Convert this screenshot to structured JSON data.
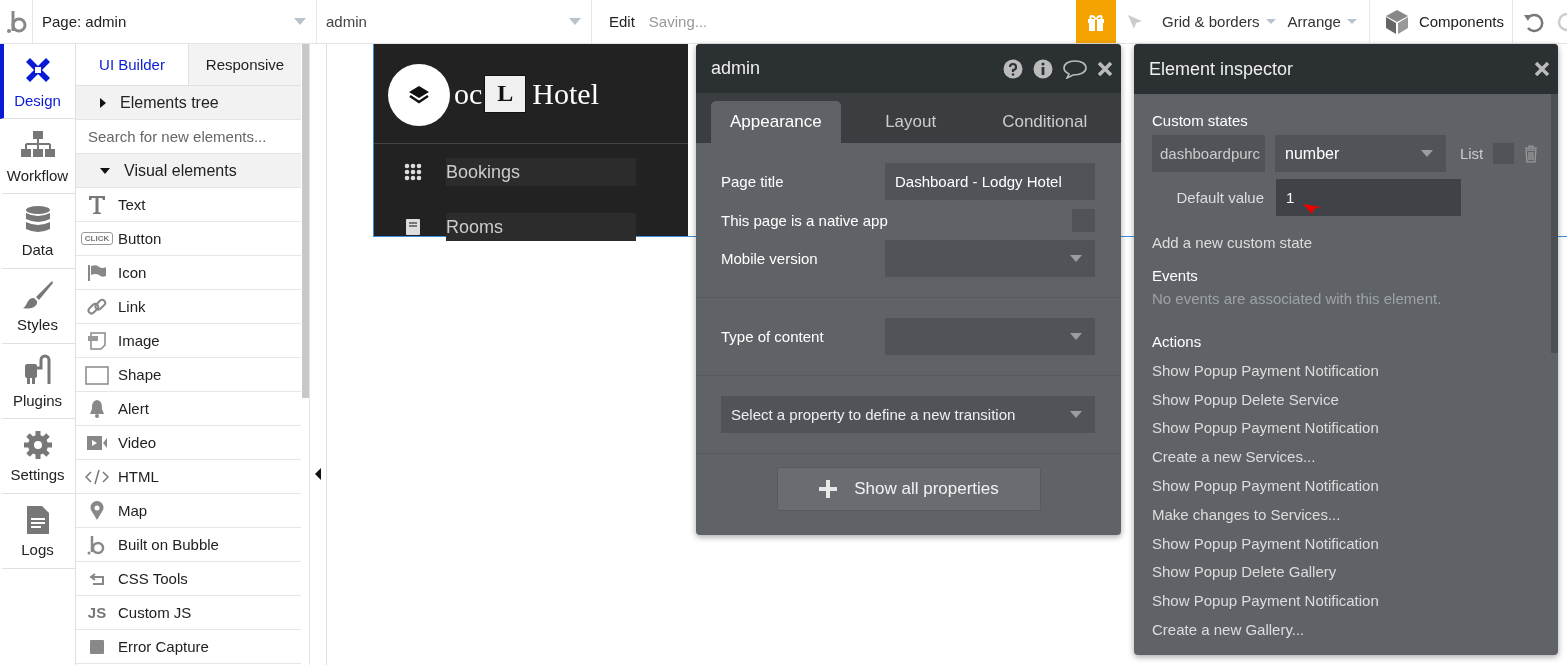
{
  "topbar": {
    "page_dropdown": "Page: admin",
    "element_dropdown": "admin",
    "edit": "Edit",
    "status": "Saving...",
    "grid_menu": "Grid & borders",
    "arrange_menu": "Arrange",
    "components": "Components"
  },
  "nav": [
    {
      "label": "Design",
      "kind": "design",
      "selected": true
    },
    {
      "label": "Workflow",
      "kind": "workflow",
      "selected": false
    },
    {
      "label": "Data",
      "kind": "data",
      "selected": false
    },
    {
      "label": "Styles",
      "kind": "styles",
      "selected": false
    },
    {
      "label": "Plugins",
      "kind": "plugins",
      "selected": false
    },
    {
      "label": "Settings",
      "kind": "settings",
      "selected": false
    },
    {
      "label": "Logs",
      "kind": "logs",
      "selected": false
    }
  ],
  "panel": {
    "tabs": [
      {
        "label": "UI Builder",
        "selected": true
      },
      {
        "label": "Responsive",
        "selected": false
      }
    ],
    "elements_tree": {
      "label": "Elements tree",
      "expanded": false
    },
    "search": {
      "placeholder": "Search for new elements..."
    },
    "visual_elements": {
      "label": "Visual elements",
      "expanded": true
    },
    "items": [
      {
        "label": "Text",
        "kind": "text"
      },
      {
        "label": "Button",
        "kind": "button",
        "badge": "CLICK"
      },
      {
        "label": "Icon",
        "kind": "icon"
      },
      {
        "label": "Link",
        "kind": "link"
      },
      {
        "label": "Image",
        "kind": "image"
      },
      {
        "label": "Shape",
        "kind": "shape"
      },
      {
        "label": "Alert",
        "kind": "alert"
      },
      {
        "label": "Video",
        "kind": "video"
      },
      {
        "label": "HTML",
        "kind": "html"
      },
      {
        "label": "Map",
        "kind": "map"
      },
      {
        "label": "Built on Bubble",
        "kind": "bubble"
      },
      {
        "label": "CSS Tools",
        "kind": "css"
      },
      {
        "label": "Custom JS",
        "kind": "js",
        "badge": "JS"
      },
      {
        "label": "Error Capture",
        "kind": "error"
      }
    ]
  },
  "preview": {
    "brand_text": "oc",
    "brand_badge": "L",
    "brand_name": "Hotel",
    "menu": [
      {
        "label": "Bookings",
        "kind": "grid"
      },
      {
        "label": "Rooms",
        "kind": "book"
      }
    ]
  },
  "property_editor": {
    "title": "admin",
    "tabs": [
      {
        "label": "Appearance",
        "selected": true
      },
      {
        "label": "Layout",
        "selected": false
      },
      {
        "label": "Conditional",
        "selected": false
      }
    ],
    "page_title": {
      "label": "Page title",
      "value": "Dashboard - Lodgy Hotel"
    },
    "native_app": {
      "label": "This page is a native app",
      "checked": false
    },
    "mobile_version": {
      "label": "Mobile version"
    },
    "type_of_content": {
      "label": "Type of content"
    },
    "transition": {
      "placeholder": "Select a property to define a new transition"
    },
    "show_all": "Show all properties"
  },
  "inspector": {
    "title": "Element inspector",
    "custom_states_heading": "Custom states",
    "state": {
      "name": "dashboardpurc",
      "type": "number",
      "list_label": "List",
      "list_checked": false
    },
    "default_value": {
      "label": "Default value",
      "value": "1"
    },
    "add_state": "Add a new custom state",
    "events_heading": "Events",
    "events_empty": "No events are associated with this element.",
    "actions_heading": "Actions",
    "actions": [
      "Show Popup Payment Notification",
      "Show Popup Delete Service",
      "Show Popup Payment Notification",
      "Create a new Services...",
      "Show Popup Payment Notification",
      "Make changes to Services...",
      "Show Popup Payment Notification",
      "Show Popup Delete Gallery",
      "Show Popup Payment Notification",
      "Create a new Gallery..."
    ]
  }
}
